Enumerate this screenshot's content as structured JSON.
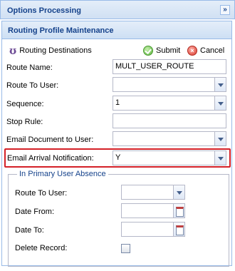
{
  "options_bar": {
    "title": "Options Processing",
    "collapse_glyph": "»"
  },
  "panel": {
    "title": "Routing Profile Maintenance"
  },
  "toolbar": {
    "routing_destinations": "Routing Destinations",
    "submit": "Submit",
    "cancel": "Cancel",
    "icons": {
      "routing": "routing-destinations-icon",
      "submit": "check-circle-icon",
      "cancel": "x-circle-icon"
    }
  },
  "form": {
    "route_name_label": "Route Name:",
    "route_name_value": "MULT_USER_ROUTE",
    "route_to_user_label": "Route To User:",
    "route_to_user_value": "",
    "sequence_label": "Sequence:",
    "sequence_value": "1",
    "stop_rule_label": "Stop Rule:",
    "stop_rule_value": "",
    "email_document_label": "Email Document to User:",
    "email_document_value": "",
    "email_arrival_label": "Email Arrival Notification:",
    "email_arrival_value": "Y"
  },
  "absence": {
    "legend": "In Primary User Absence",
    "route_to_user_label": "Route To User:",
    "route_to_user_value": "",
    "date_from_label": "Date From:",
    "date_from_value": "",
    "date_to_label": "Date To:",
    "date_to_value": "",
    "delete_record_label": "Delete Record:",
    "delete_record_checked": false
  },
  "colors": {
    "header_text": "#15428b",
    "border": "#99bbe8",
    "highlight": "#d42027"
  }
}
